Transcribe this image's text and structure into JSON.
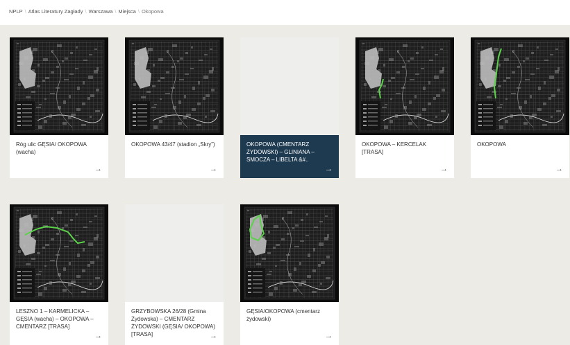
{
  "breadcrumb": [
    {
      "label": "NPLP"
    },
    {
      "label": "Atlas Literatury Zagłady"
    },
    {
      "label": "Warszawa"
    },
    {
      "label": "Miejsca"
    },
    {
      "label": "Okopowa"
    }
  ],
  "breadcrumb_separator": "\\",
  "arrow_glyph": "→",
  "colors": {
    "active_caption_bg": "#1d3a50",
    "route_highlight": "#5bd24a",
    "page_bg": "#ecebe6"
  },
  "cards": [
    {
      "title": "Róg ulic GĘSIA/ OKOPOWA (wacha)",
      "thumbnail": "map",
      "route": "none"
    },
    {
      "title": "OKOPOWA 43/47 (stadion „Skry”)",
      "thumbnail": "map",
      "route": "none"
    },
    {
      "title": "OKOPOWA (CMENTARZ ŻYDOWSKI) – GLINIANA – SMOCZA – LIBELTA &#..",
      "thumbnail": "blank",
      "active": true
    },
    {
      "title": "OKOPOWA – KERCELAK [TRASA]",
      "thumbnail": "map",
      "route": "short-vertical"
    },
    {
      "title": "OKOPOWA",
      "thumbnail": "map",
      "route": "long-vertical"
    },
    {
      "title": "LESZNO 1 – KARMELICKA – GĘSIA (wacha) – OKOPOWA – CMENTARZ [TRASA]",
      "thumbnail": "map",
      "route": "horizontal"
    },
    {
      "title": "GRZYBOWSKA 26/28 (Gmina Żydowska) – CMENTARZ ŻYDOWSKI (GĘSIA/ OKOPOWA) [TRASA]",
      "thumbnail": "blank"
    },
    {
      "title": "GĘSIA/OKOPOWA (cmentarz żydowski)",
      "thumbnail": "map",
      "route": "area"
    }
  ]
}
